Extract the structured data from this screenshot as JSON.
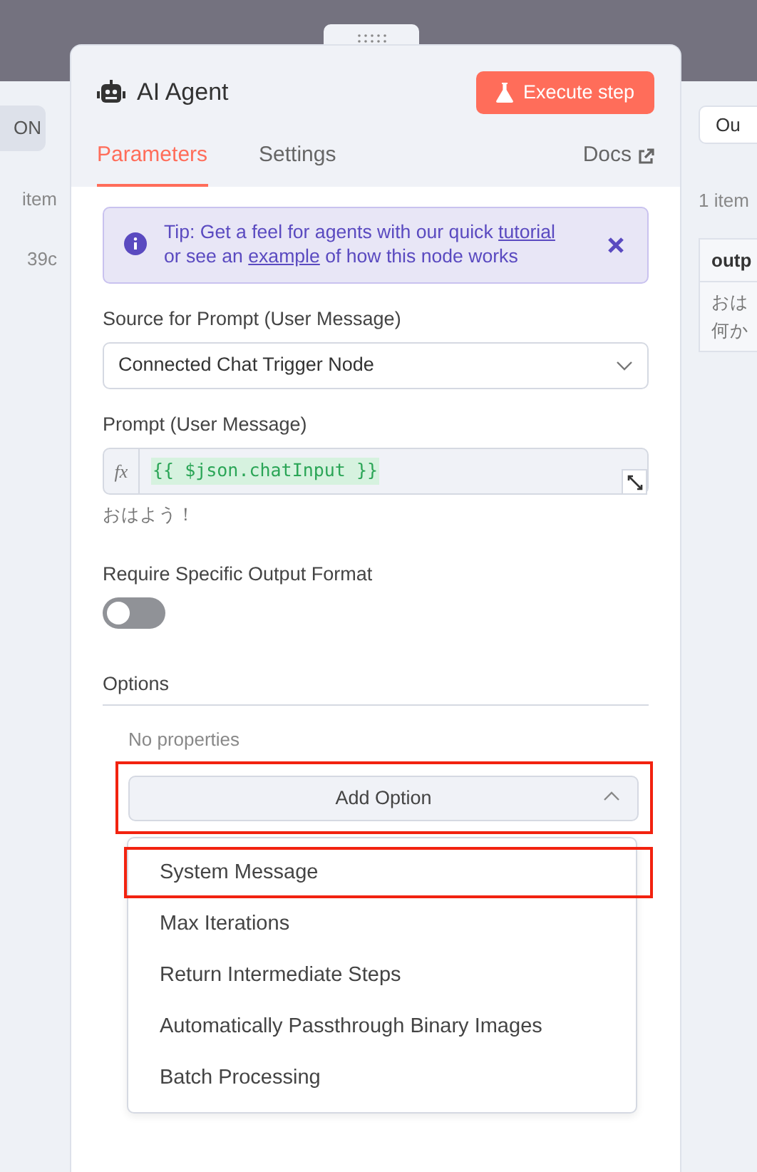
{
  "left_panel": {
    "button": "ON",
    "item_count": "item",
    "value": "39c"
  },
  "node_panel": {
    "title": "AI Agent",
    "execute_button": "Execute step",
    "tabs": [
      {
        "label": "Parameters",
        "selected": true
      },
      {
        "label": "Settings",
        "selected": false
      }
    ],
    "docs_link": "Docs",
    "tip": {
      "parts": [
        {
          "kind": "text",
          "text": "Tip: Get a feel for agents with our quick "
        },
        {
          "kind": "link",
          "text": "tutorial"
        },
        {
          "kind": "text",
          "text": " or see an "
        },
        {
          "kind": "link",
          "text": "example"
        },
        {
          "kind": "text",
          "text": " of how this node works"
        }
      ]
    },
    "source_field": {
      "label": "Source for Prompt (User Message)",
      "value": "Connected Chat Trigger Node"
    },
    "prompt_field": {
      "label": "Prompt (User Message)",
      "fx": "fx",
      "value": "{{ $json.chatInput }}",
      "preview": "おはよう！"
    },
    "output_format": {
      "label": "Require Specific Output Format",
      "on": false
    },
    "options": {
      "label": "Options",
      "empty_text": "No properties",
      "add_button": "Add Option",
      "highlighted": true,
      "expanded": true,
      "menu": [
        {
          "label": "System Message",
          "highlighted": true
        },
        {
          "label": "Max Iterations",
          "highlighted": false
        },
        {
          "label": "Return Intermediate Steps",
          "highlighted": false
        },
        {
          "label": "Automatically Passthrough Binary Images",
          "highlighted": false
        },
        {
          "label": "Batch Processing",
          "highlighted": false
        }
      ]
    }
  },
  "right_panel": {
    "tab": "Ou",
    "item_count": "1 item",
    "table": {
      "columns": [
        "outp"
      ],
      "rows": [
        {
          "lines": [
            "おは",
            "何か"
          ]
        }
      ]
    }
  }
}
